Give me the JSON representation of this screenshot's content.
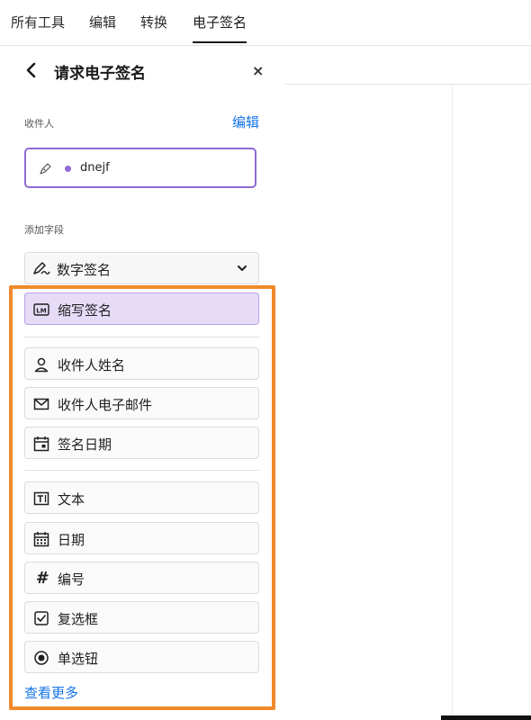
{
  "topnav": {
    "tabs": [
      {
        "label": "所有工具"
      },
      {
        "label": "编辑"
      },
      {
        "label": "转换"
      },
      {
        "label": "电子签名"
      }
    ]
  },
  "panel": {
    "title": "请求电子签名",
    "close_label": "×",
    "recipients_label": "收件人",
    "edit_label": "编辑",
    "recipient": {
      "name": "dnejf",
      "dot_color": "#8e6ad6"
    },
    "add_fields_label": "添加字段",
    "dropdown_selected": "数字签名",
    "fields": [
      {
        "label": "缩写签名",
        "icon": "initials-icon",
        "selected": true
      },
      {
        "label": "收件人姓名",
        "icon": "person-icon"
      },
      {
        "label": "收件人电子邮件",
        "icon": "mail-icon"
      },
      {
        "label": "签名日期",
        "icon": "calendar-signed-icon"
      },
      {
        "label": "文本",
        "icon": "text-field-icon"
      },
      {
        "label": "日期",
        "icon": "calendar-icon"
      },
      {
        "label": "编号",
        "icon": "hash-icon",
        "glyph": "#"
      },
      {
        "label": "复选框",
        "icon": "checkbox-icon"
      },
      {
        "label": "单选钮",
        "icon": "radio-icon"
      }
    ],
    "see_more_label": "查看更多"
  },
  "colors": {
    "accent_link": "#1473e6",
    "selected_bg": "#e7dcf8",
    "highlight": "#f08a2b"
  }
}
